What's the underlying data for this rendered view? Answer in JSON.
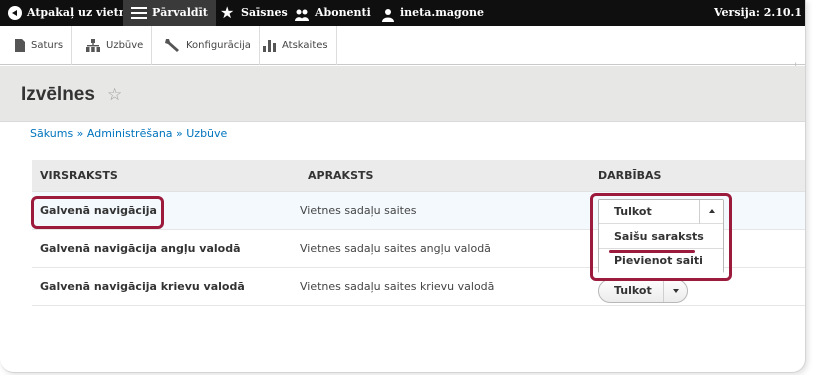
{
  "toolbar": {
    "back_label": "Atpakaļ uz vietni",
    "manage_label": "Pārvaldīt",
    "shortcuts_label": "Saīsnes",
    "subscribers_label": "Abonenti",
    "user_label": "ineta.magone",
    "version_label": "Versija: 2.10.1"
  },
  "tray": {
    "items": [
      {
        "label": "Saturs",
        "icon": "content-icon"
      },
      {
        "label": "Uzbūve",
        "icon": "structure-icon"
      },
      {
        "label": "Konfigurācija",
        "icon": "wrench-icon"
      },
      {
        "label": "Atskaites",
        "icon": "reports-icon"
      }
    ]
  },
  "page": {
    "title": "Izvēlnes",
    "title_star": "☆"
  },
  "breadcrumb": "Sākums » Administrēšana » Uzbūve",
  "table": {
    "headers": [
      "VIRSRAKSTS",
      "APRAKSTS",
      "DARBĪBAS"
    ],
    "rows": [
      {
        "title": "Galvenā navigācija",
        "description": "Vietnes sadaļu saites"
      },
      {
        "title": "Galvenā navigācija angļu valodā",
        "description": "Vietnes sadaļu saites angļu valodā"
      },
      {
        "title": "Galvenā navigācija krievu valodā",
        "description": "Vietnes sadaļu saites krievu valodā"
      }
    ]
  },
  "dropdown": {
    "primary": "Tulkot",
    "items": [
      "Saišu saraksts",
      "Pievienot saiti"
    ]
  },
  "row3_button": "Tulkot",
  "colors": {
    "toolbar_bg": "#0f0f0f",
    "link": "#0074bd",
    "highlight_row": "#f4f9fd",
    "emphasis": "#9c1b3c"
  }
}
